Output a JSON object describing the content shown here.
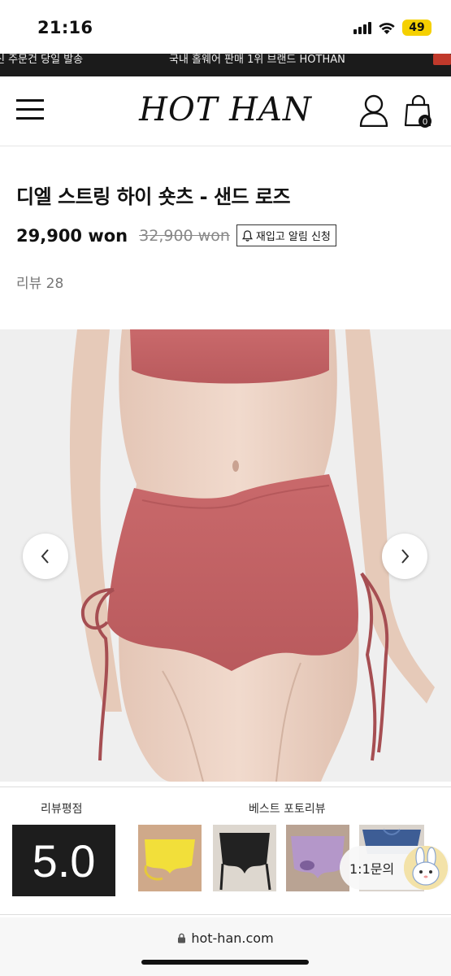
{
  "status_bar": {
    "time": "21:16",
    "battery": "49"
  },
  "marquee": {
    "left_text": "신 주문건 당일 발송",
    "center_text": "국내 홀웨어 판매 1위 브랜드 HOTHAN"
  },
  "header": {
    "logo": "HOT HAN",
    "cart_count": "0"
  },
  "product": {
    "title": "디엘 스트링 하이 숏츠 - 샌드 로즈",
    "price": "29,900 won",
    "original_price": "32,900 won",
    "restock_label": "재입고 알림 신청",
    "review_count": "리뷰 28"
  },
  "review_widget": {
    "rating_label": "리뷰평점",
    "rating": "5.0",
    "best_label": "베스트 포토리뷰",
    "chat_label": "1:1문의"
  },
  "browser": {
    "url": "hot-han.com"
  },
  "colors": {
    "product_pink": "#c8686a",
    "banner_bg": "#1b1b1b",
    "battery": "#f5d000"
  }
}
